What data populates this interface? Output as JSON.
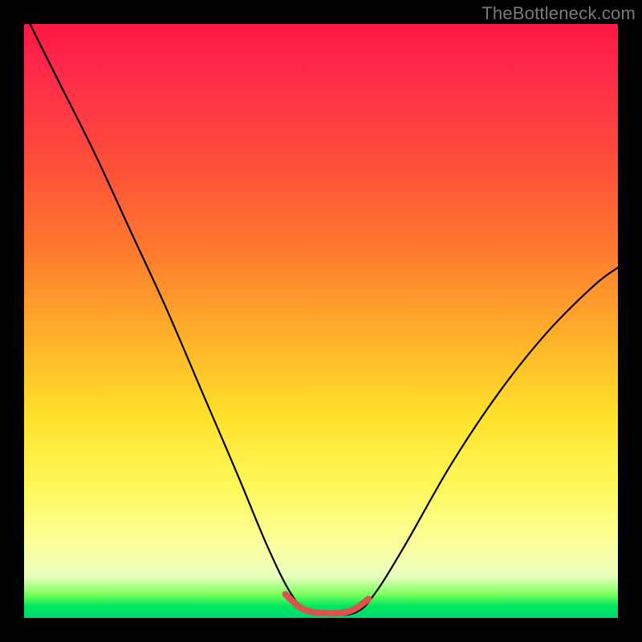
{
  "attribution": "TheBottleneck.com",
  "chart_data": {
    "type": "line",
    "title": "",
    "xlabel": "",
    "ylabel": "",
    "xlim": [
      0,
      100
    ],
    "ylim": [
      0,
      100
    ],
    "background_gradient_stops": [
      {
        "pos": 0,
        "color": "#ff1744"
      },
      {
        "pos": 22,
        "color": "#ff4a3c"
      },
      {
        "pos": 52,
        "color": "#ffae2a"
      },
      {
        "pos": 78,
        "color": "#fff95a"
      },
      {
        "pos": 96,
        "color": "#7cff5c"
      },
      {
        "pos": 100,
        "color": "#00d870"
      }
    ],
    "series": [
      {
        "name": "bottleneck-curve",
        "color": "#000000",
        "points": [
          {
            "x": 1,
            "y": 100
          },
          {
            "x": 6,
            "y": 90
          },
          {
            "x": 12,
            "y": 78
          },
          {
            "x": 18,
            "y": 65
          },
          {
            "x": 24,
            "y": 52
          },
          {
            "x": 30,
            "y": 38
          },
          {
            "x": 36,
            "y": 24
          },
          {
            "x": 41,
            "y": 12
          },
          {
            "x": 45,
            "y": 4
          },
          {
            "x": 48,
            "y": 1
          },
          {
            "x": 52,
            "y": 0.5
          },
          {
            "x": 56,
            "y": 1
          },
          {
            "x": 59,
            "y": 4
          },
          {
            "x": 64,
            "y": 12
          },
          {
            "x": 72,
            "y": 26
          },
          {
            "x": 80,
            "y": 38
          },
          {
            "x": 88,
            "y": 48
          },
          {
            "x": 96,
            "y": 56
          },
          {
            "x": 100,
            "y": 59
          }
        ]
      },
      {
        "name": "bottom-highlight",
        "color": "#d9544d",
        "width": 8,
        "points": [
          {
            "x": 44,
            "y": 4
          },
          {
            "x": 47,
            "y": 1.5
          },
          {
            "x": 51,
            "y": 0.8
          },
          {
            "x": 55,
            "y": 1.2
          },
          {
            "x": 58,
            "y": 3.2
          }
        ]
      }
    ]
  }
}
